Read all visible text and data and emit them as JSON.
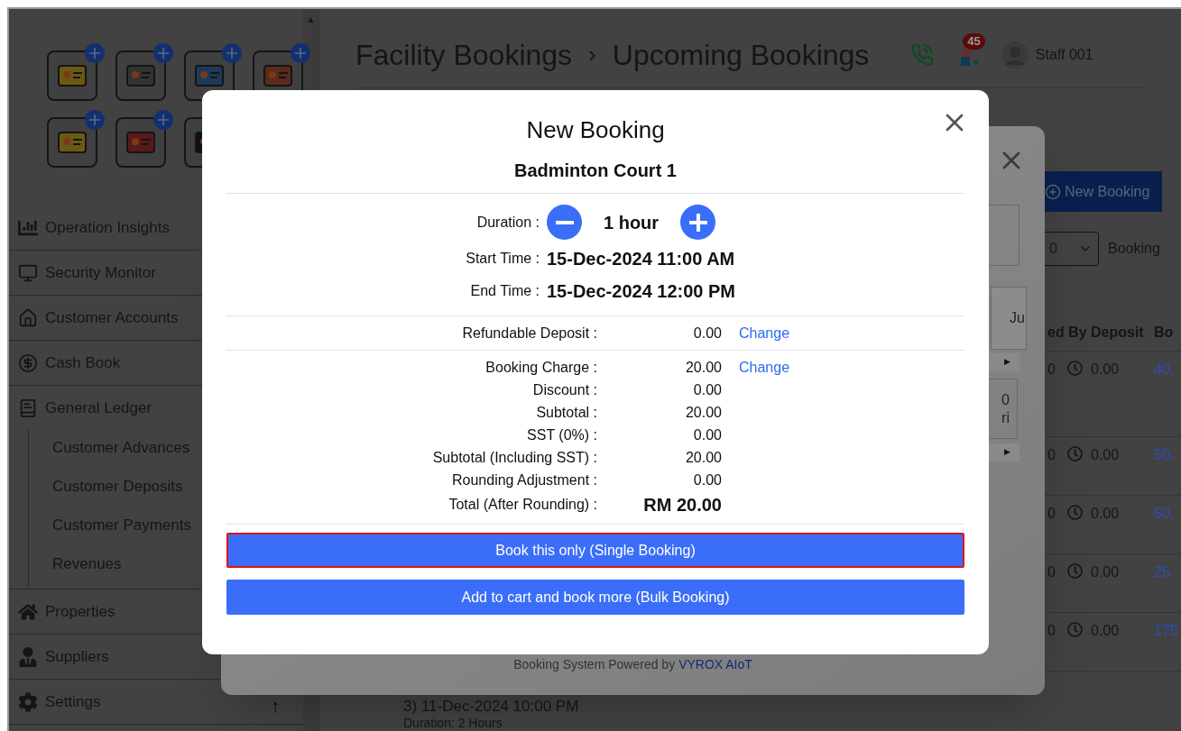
{
  "sidebar": {
    "scroll_up": "▲",
    "back_to_top": "↑",
    "menu": [
      {
        "label": "Operation Insights"
      },
      {
        "label": "Security Monitor"
      },
      {
        "label": "Customer Accounts"
      },
      {
        "label": "Cash Book"
      },
      {
        "label": "General Ledger",
        "children": [
          {
            "label": "Customer Advances"
          },
          {
            "label": "Customer Deposits"
          },
          {
            "label": "Customer Payments"
          },
          {
            "label": "Revenues"
          }
        ]
      },
      {
        "label": "Properties"
      },
      {
        "label": "Suppliers"
      },
      {
        "label": "Settings"
      }
    ]
  },
  "header": {
    "breadcrumb": [
      "Facility Bookings",
      "Upcoming Bookings"
    ],
    "separator": "›",
    "notification_count": "45",
    "user": "Staff 001"
  },
  "page": {
    "new_booking_button": "New Booking",
    "page_size": "0",
    "page_size_label": "Booking",
    "columns": [
      "ed By",
      "Deposit",
      "Bo"
    ],
    "rows": [
      {
        "column_1": "0",
        "deposit": "0.00",
        "column_3": "40."
      },
      {
        "column_1": "0",
        "deposit": "0.00",
        "column_3": "50."
      },
      {
        "column_1": "0",
        "deposit": "0.00",
        "column_3": "50."
      },
      {
        "column_1": "0",
        "deposit": "0.00",
        "column_3": "25."
      },
      {
        "column_1": "0",
        "deposit": "0.00",
        "column_3": "175"
      }
    ],
    "booking_item": {
      "title": "3) 11-Dec-2024 10:00 PM",
      "duration": "Duration: 2 Hours"
    }
  },
  "background_dialog": {
    "fragment_1": "Ju",
    "fragment_2": [
      "0",
      "ri"
    ],
    "scroll_arrow": "▶",
    "footer": "Booking System Powered by",
    "footer_link": "VYROX AIoT"
  },
  "dialog": {
    "title": "New Booking",
    "facility": "Badminton Court 1",
    "duration_label": "Duration :",
    "duration": "1 hour",
    "times": [
      {
        "label": "Start Time :",
        "value": "15-Dec-2024 11:00 AM"
      },
      {
        "label": "End Time :",
        "value": "15-Dec-2024 12:00 PM"
      }
    ],
    "sections": [
      [
        {
          "label": "Refundable Deposit :",
          "value": "0.00",
          "action": "Change",
          "kind": "line"
        }
      ],
      [
        {
          "label": "Booking Charge :",
          "value": "20.00",
          "action": "Change",
          "kind": "line"
        },
        {
          "label": "Discount :",
          "value": "0.00",
          "kind": "line"
        },
        {
          "label": "Subtotal :",
          "value": "20.00",
          "kind": "line"
        },
        {
          "label": "SST (0%) :",
          "value": "0.00",
          "kind": "line"
        },
        {
          "label": "Subtotal (Including SST) :",
          "value": "20.00",
          "kind": "line"
        },
        {
          "label": "Rounding Adjustment :",
          "value": "0.00",
          "kind": "line"
        },
        {
          "label": "Total (After Rounding) :",
          "value": "RM 20.00",
          "kind": "total"
        }
      ]
    ],
    "buttons": [
      {
        "label": "Book this only (Single Booking)",
        "focused": true
      },
      {
        "label": "Add to cart and book more (Bulk Booking)",
        "focused": false
      }
    ]
  }
}
